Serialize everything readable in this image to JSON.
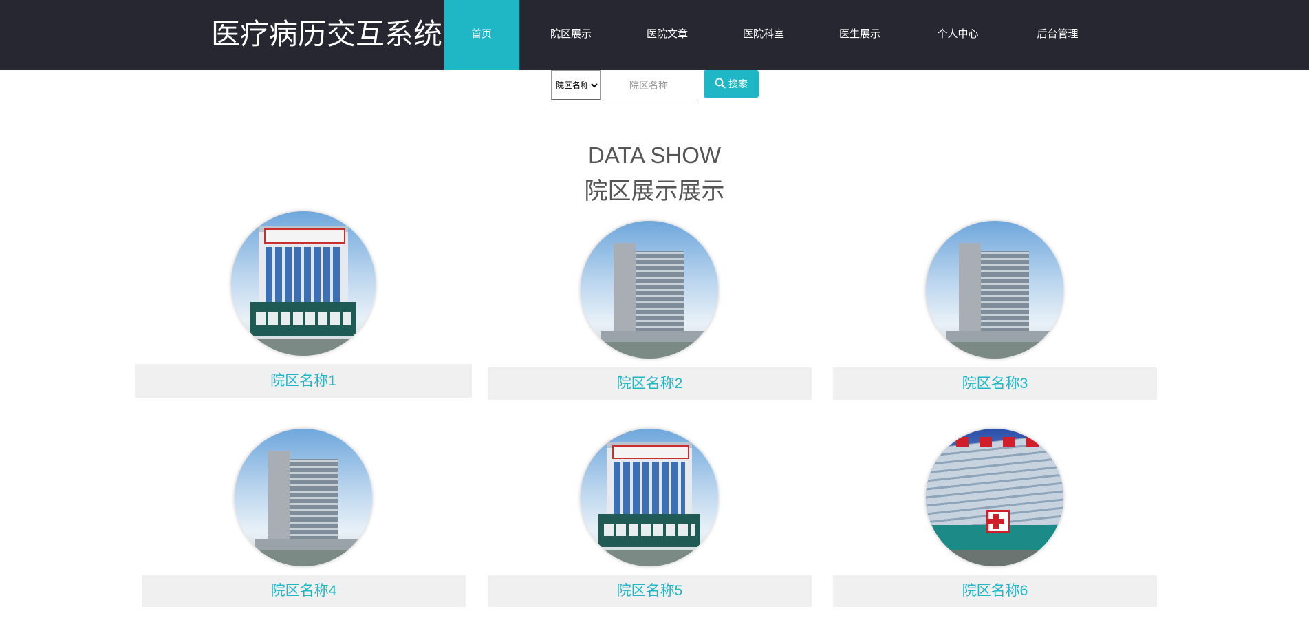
{
  "header": {
    "title": "医疗病历交互系统",
    "nav": [
      {
        "label": "首页",
        "active": true
      },
      {
        "label": "院区展示",
        "active": false
      },
      {
        "label": "医院文章",
        "active": false
      },
      {
        "label": "医院科室",
        "active": false
      },
      {
        "label": "医生展示",
        "active": false
      },
      {
        "label": "个人中心",
        "active": false
      },
      {
        "label": "后台管理",
        "active": false
      }
    ],
    "accent_color": "#1fb7c6",
    "background_color": "#272731"
  },
  "search": {
    "select_value": "院区名称",
    "input_placeholder": "院区名称",
    "button_label": "搜索",
    "button_icon": "search-icon"
  },
  "section": {
    "title_en": "DATA SHOW",
    "title_cn": "院区展示展示"
  },
  "cards": [
    {
      "name": "院区名称1",
      "image": "hospital-building-photo"
    },
    {
      "name": "院区名称2",
      "image": "hospital-tower-photo"
    },
    {
      "name": "院区名称3",
      "image": "hospital-tower-photo"
    },
    {
      "name": "院区名称4",
      "image": "hospital-tower-photo"
    },
    {
      "name": "院区名称5",
      "image": "hospital-building-photo"
    },
    {
      "name": "院区名称6",
      "image": "hospital-building-photo"
    }
  ]
}
